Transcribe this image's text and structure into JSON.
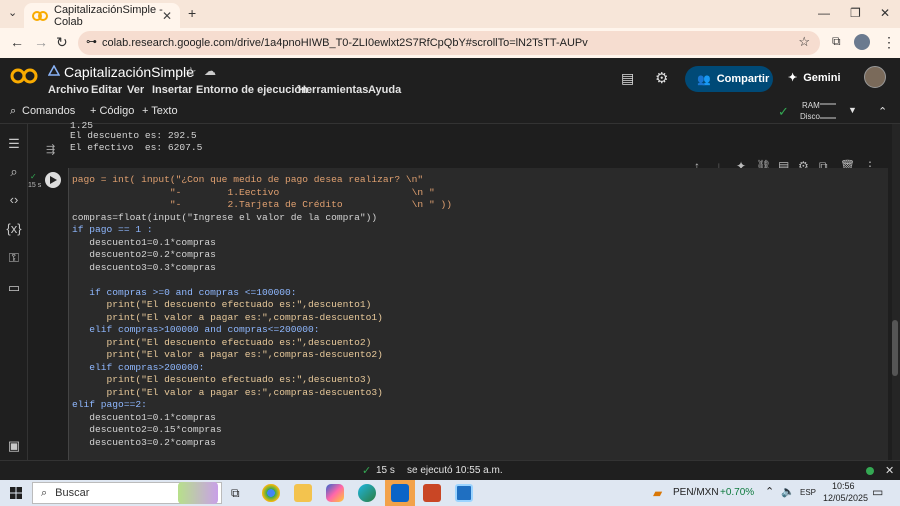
{
  "browser": {
    "tab_title": "CapitalizaciónSimple - Colab",
    "url": "colab.research.google.com/drive/1a4pnoHIWB_T0-ZLI0ewlxt2S7RfCpQbY#scrollTo=lN2TsTT-AUPv"
  },
  "colab": {
    "notebook_title": "CapitalizaciónSimple",
    "menu": [
      "Archivo",
      "Editar",
      "Ver",
      "Insertar",
      "Entorno de ejecución",
      "Herramientas",
      "Ayuda"
    ],
    "share_label": "Compartir",
    "gemini_label": "Gemini",
    "commands_label": "Comandos",
    "add_code_label": "+ Código",
    "add_text_label": "+ Texto",
    "ram_label": "RAM",
    "disk_label": "Disco"
  },
  "output_prev": {
    "line0": "1.25",
    "line1": "El descuento es: 292.5",
    "line2": "El efectivo  es: 6207.5"
  },
  "cell": {
    "exec_time": "15 s",
    "code_lines": [
      "pago = int( input(\"¿Con que medio de pago desea realizar? \\n\"",
      "                 \"-        1.Eectivo                       \\n \"",
      "                 \"-        2.Tarjeta de Crédito            \\n \" ))",
      "compras=float(input(\"Ingrese el valor de la compra\"))",
      "if pago == 1 :",
      "   descuento1=0.1*compras",
      "   descuento2=0.2*compras",
      "   descuento3=0.3*compras",
      "",
      "   if compras >=0 and compras <=100000:",
      "      print(\"El descuento efectuado es:\",descuento1)",
      "      print(\"El valor a pagar es:\",compras-descuento1)",
      "   elif compras>100000 and compras<=200000:",
      "      print(\"El descuento efectuado es:\",descuento2)",
      "      print(\"El valor a pagar es:\",compras-descuento2)",
      "   elif compras>200000:",
      "      print(\"El descuento efectuado es:\",descuento3)",
      "      print(\"El valor a pagar es:\",compras-descuento3)",
      "elif pago==2:",
      "   descuento1=0.1*compras",
      "   descuento2=0.15*compras",
      "   descuento3=0.2*compras"
    ]
  },
  "status": {
    "time": "15 s",
    "message": "se ejecutó 10:55 a.m."
  },
  "taskbar": {
    "search_label": "Buscar",
    "currency": "PEN/MXN",
    "change": "+0.70%",
    "lang": "ESP",
    "clock_time": "10:56",
    "clock_date": "12/05/2025"
  },
  "colors": {
    "accent_blue": "#0b57d0",
    "share_bg": "#004a77",
    "change_green": "#0f7b3f",
    "ok_green": "#34a853"
  }
}
